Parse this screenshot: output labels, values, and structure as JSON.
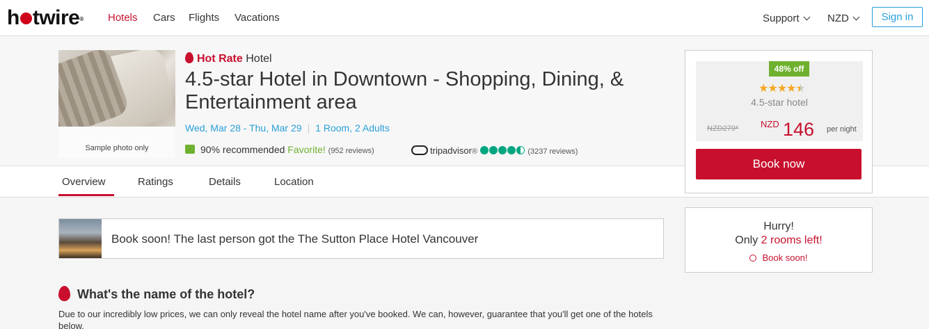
{
  "header": {
    "logo": "hotwire",
    "nav": [
      "Hotels",
      "Cars",
      "Flights",
      "Vacations"
    ],
    "support": "Support",
    "currency": "NZD",
    "signin": "Sign in"
  },
  "hotel": {
    "photo_caption": "Sample photo only",
    "hot_rate": "Hot Rate",
    "hot_rate_type": "Hotel",
    "title": "4.5-star Hotel in Downtown - Shopping, Dining, & Entertainment area",
    "dates": "Wed, Mar 28 - Thu, Mar 29",
    "rooms": "1 Room,  2 Adults",
    "recommended": "90% recommended",
    "favorite": "Favorite!",
    "reviews": "(952 reviews)",
    "tripadvisor": "tripadvisor",
    "trip_reviews": "(3237 reviews)",
    "tripadvisor_rating": 4.5
  },
  "tabs": [
    "Overview",
    "Ratings",
    "Details",
    "Location"
  ],
  "price": {
    "discount": "48% off",
    "star_rating": 4.5,
    "star_label": "4.5-star hotel",
    "old_price": "NZD279*",
    "currency": "NZD",
    "amount": "146",
    "per": "per night",
    "book": "Book now"
  },
  "urgency": {
    "line1": "Hurry!",
    "line2_prefix": "Only",
    "line2_red": "2 rooms left!",
    "line3": "Book soon!"
  },
  "notice": "Book soon! The last person got the The Sutton Place Hotel Vancouver",
  "section": {
    "title": "What's the name of the hotel?",
    "text": "Due to our incredibly low prices, we can only reveal the hotel name after you've booked. We can, however, guarantee that you'll get one of the hotels below."
  },
  "colors": {
    "brand": "#c8102e",
    "link": "#2a9fd8",
    "green": "#6fb12f"
  }
}
